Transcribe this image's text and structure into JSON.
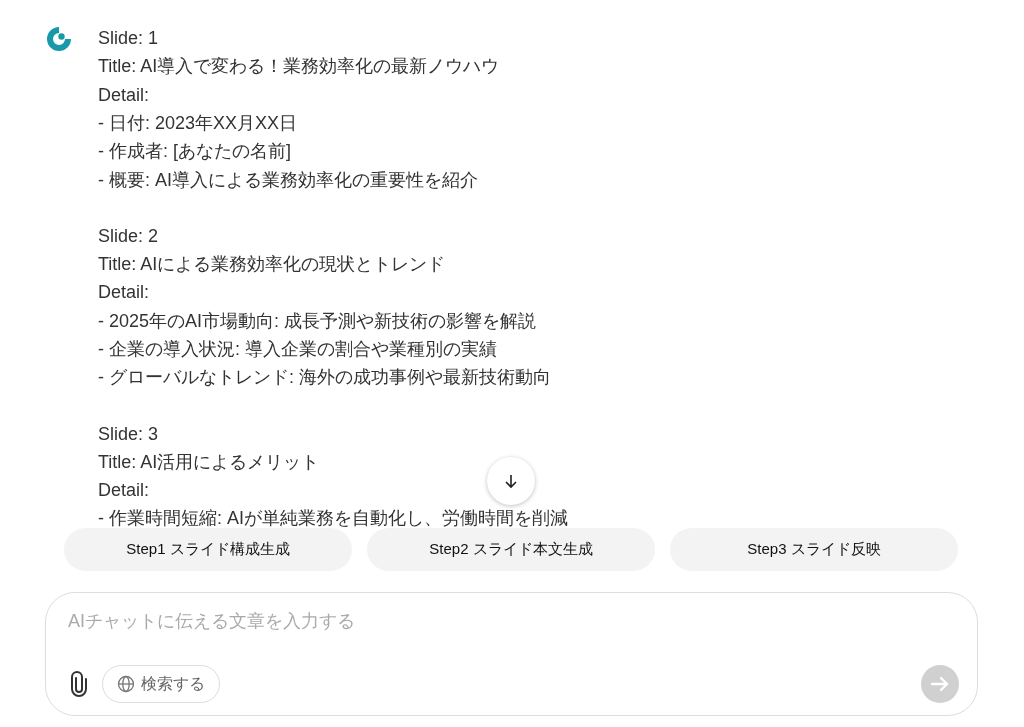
{
  "message": {
    "slides": [
      {
        "lines": [
          "Slide: 1",
          "Title: AI導入で変わる！業務効率化の最新ノウハウ",
          "Detail:",
          "- 日付: 2023年XX月XX日",
          "- 作成者: [あなたの名前]",
          "- 概要: AI導入による業務効率化の重要性を紹介"
        ]
      },
      {
        "lines": [
          "Slide: 2",
          "Title: AIによる業務効率化の現状とトレンド",
          "Detail:",
          "- 2025年のAI市場動向: 成長予測や新技術の影響を解説",
          "- 企業の導入状況: 導入企業の割合や業種別の実績",
          "- グローバルなトレンド: 海外の成功事例や最新技術動向"
        ]
      },
      {
        "lines": [
          "Slide: 3",
          "Title: AI活用によるメリット",
          "Detail:",
          "- 作業時間短縮: AIが単純業務を自動化し、労働時間を削減"
        ]
      }
    ]
  },
  "steps": [
    "Step1 スライド構成生成",
    "Step2 スライド本文生成",
    "Step3 スライド反映"
  ],
  "composer": {
    "placeholder": "AIチャットに伝える文章を入力する",
    "search_label": "検索する",
    "send_disabled": true
  }
}
